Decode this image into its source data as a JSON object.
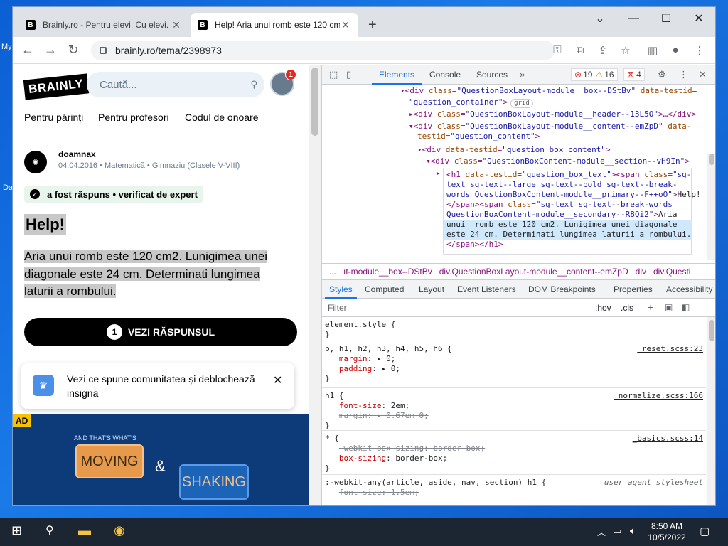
{
  "desktop": {
    "label_top": "My",
    "label_bottom": "Da"
  },
  "browser": {
    "tabs": [
      {
        "title": "Brainly.ro - Pentru elevi. Cu elevi.",
        "favicon": "B"
      },
      {
        "title": "Help! Aria unui romb este 120 cm",
        "favicon": "B"
      }
    ],
    "new_tab": "+",
    "url": "brainly.ro/tema/2398973"
  },
  "page": {
    "logo": "BRAINLY",
    "search_placeholder": "Caută...",
    "notification_count": "1",
    "menu": [
      "Pentru părinți",
      "Pentru profesori",
      "Codul de onoare"
    ],
    "question": {
      "author": "doamnax",
      "meta": "04.04.2016 • Matematică • Gimnaziu (Clasele V-VIII)",
      "verified": "a fost răspuns • verificat de expert",
      "title": "Help!",
      "text": "Aria unui romb este 120 cm2. Lunigimea unei diagonale este 24 cm. Determinati lungimea laturii a rombului.",
      "answer_button": "VEZI RĂSPUNSUL",
      "answer_count": "1"
    },
    "toast": {
      "message": "Vezi ce spune comunitatea și deblochează insigna"
    },
    "ad": {
      "label": "AD",
      "sub": "AND THAT'S WHAT'S",
      "word1": "MOVING",
      "amp": "&",
      "word2": "SHAKING"
    }
  },
  "devtools": {
    "tabs": [
      "Elements",
      "Console",
      "Sources"
    ],
    "errors": "19",
    "warnings": "16",
    "issues": "4",
    "crumbs": [
      "...",
      "ıt-module__box--DStBv",
      "div.QuestionBoxLayout-module__content--emZpD",
      "div",
      "div.Questi"
    ],
    "subtabs": [
      "Styles",
      "Computed",
      "Layout",
      "Event Listeners",
      "DOM Breakpoints",
      "Properties",
      "Accessibility"
    ],
    "filter": "Filter",
    "hov": ":hov",
    "cls": ".cls",
    "grid_pill": "grid"
  },
  "taskbar": {
    "time": "8:50 AM",
    "date": "10/5/2022"
  }
}
